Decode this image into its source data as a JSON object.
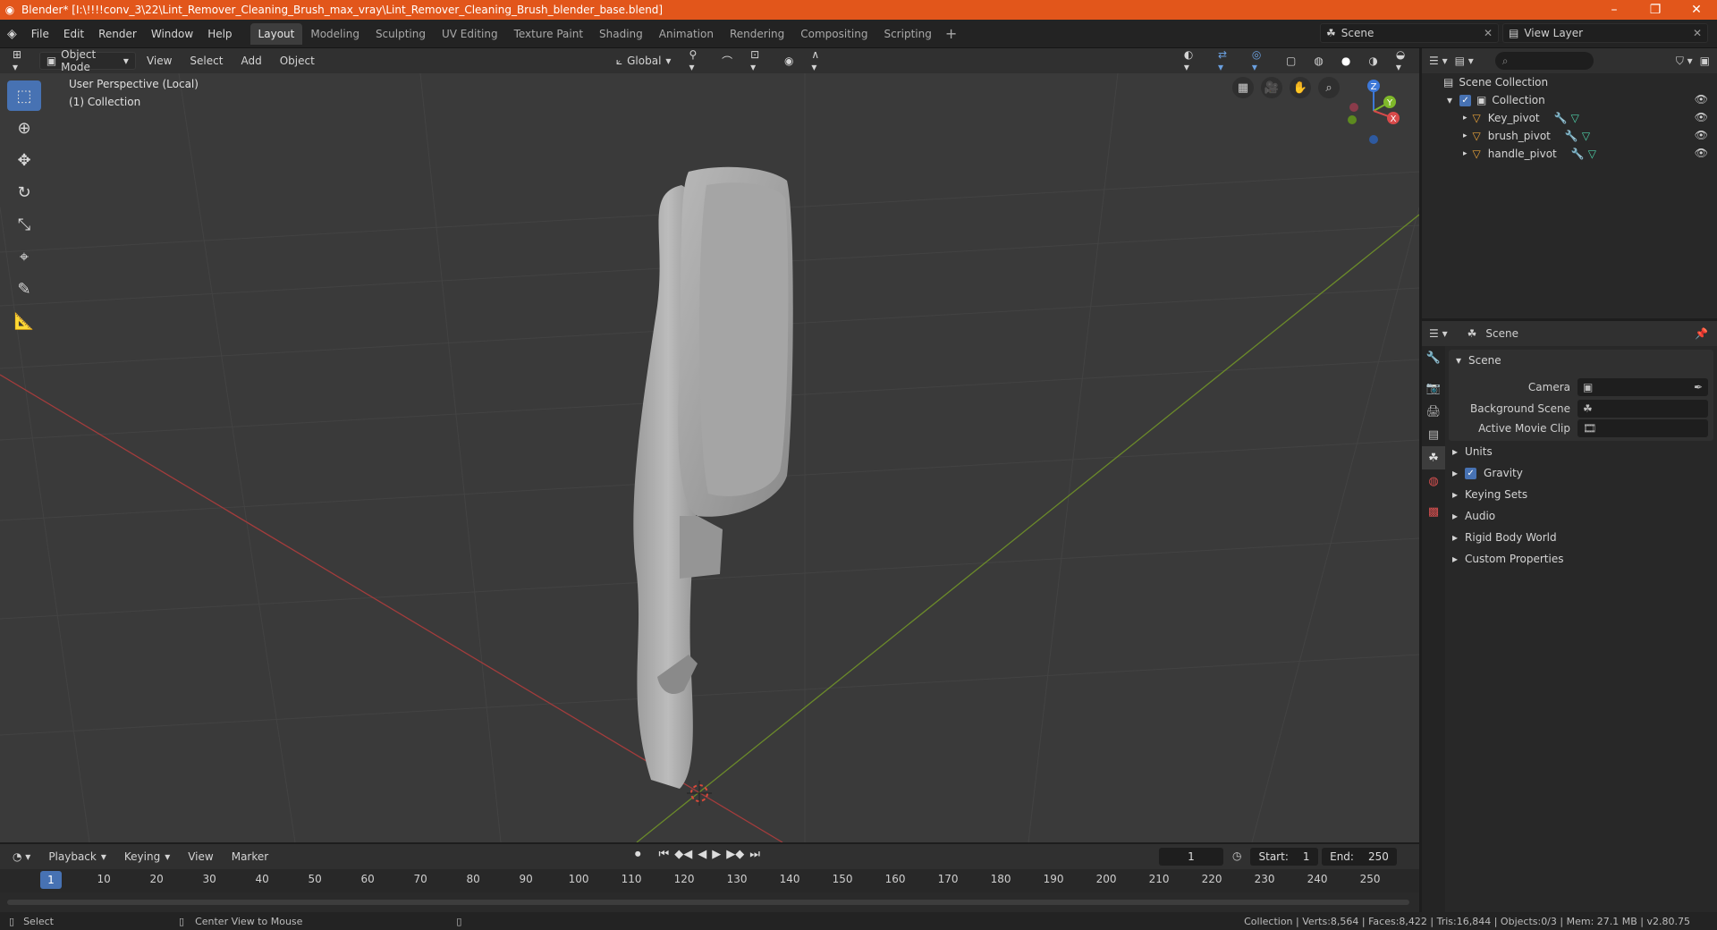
{
  "window": {
    "title": "Blender* [I:\\!!!!conv_3\\22\\Lint_Remover_Cleaning_Brush_max_vray\\Lint_Remover_Cleaning_Brush_blender_base.blend]"
  },
  "menu": [
    "File",
    "Edit",
    "Render",
    "Window",
    "Help"
  ],
  "workspace_tabs": [
    "Layout",
    "Modeling",
    "Sculpting",
    "UV Editing",
    "Texture Paint",
    "Shading",
    "Animation",
    "Rendering",
    "Compositing",
    "Scripting"
  ],
  "active_tab": "Layout",
  "scene_field": "Scene",
  "view_layer_field": "View Layer",
  "viewport_header": {
    "mode": "Object Mode",
    "menus": [
      "View",
      "Select",
      "Add",
      "Object"
    ],
    "transform": "Global"
  },
  "viewport": {
    "perspective": "User Perspective (Local)",
    "collection": "(1) Collection",
    "gizmo_axes": [
      "Z",
      "Y",
      "X"
    ]
  },
  "outliner": {
    "root": "Scene Collection",
    "collection": "Collection",
    "objects": [
      "Key_pivot",
      "brush_pivot",
      "handle_pivot"
    ]
  },
  "properties": {
    "header": "Scene",
    "panel_title": "Scene",
    "fields": [
      {
        "label": "Camera",
        "value": ""
      },
      {
        "label": "Background Scene",
        "value": ""
      },
      {
        "label": "Active Movie Clip",
        "value": ""
      }
    ],
    "sections": [
      "Units",
      "Gravity",
      "Keying Sets",
      "Audio",
      "Rigid Body World",
      "Custom Properties"
    ]
  },
  "timeline": {
    "menus": [
      "Playback",
      "Keying",
      "View",
      "Marker"
    ],
    "current_frame": "1",
    "start_label": "Start:",
    "start": "1",
    "end_label": "End:",
    "end": "250",
    "ruler_ticks": [
      "1",
      "10",
      "20",
      "30",
      "40",
      "50",
      "60",
      "70",
      "80",
      "90",
      "100",
      "110",
      "120",
      "130",
      "140",
      "150",
      "160",
      "170",
      "180",
      "190",
      "200",
      "210",
      "220",
      "230",
      "240",
      "250"
    ]
  },
  "statusbar": {
    "left": "Select",
    "middle": "Center View to Mouse",
    "right": "Collection | Verts:8,564 | Faces:8,422 | Tris:16,844 | Objects:0/3 | Mem: 27.1 MB | v2.80.75"
  }
}
